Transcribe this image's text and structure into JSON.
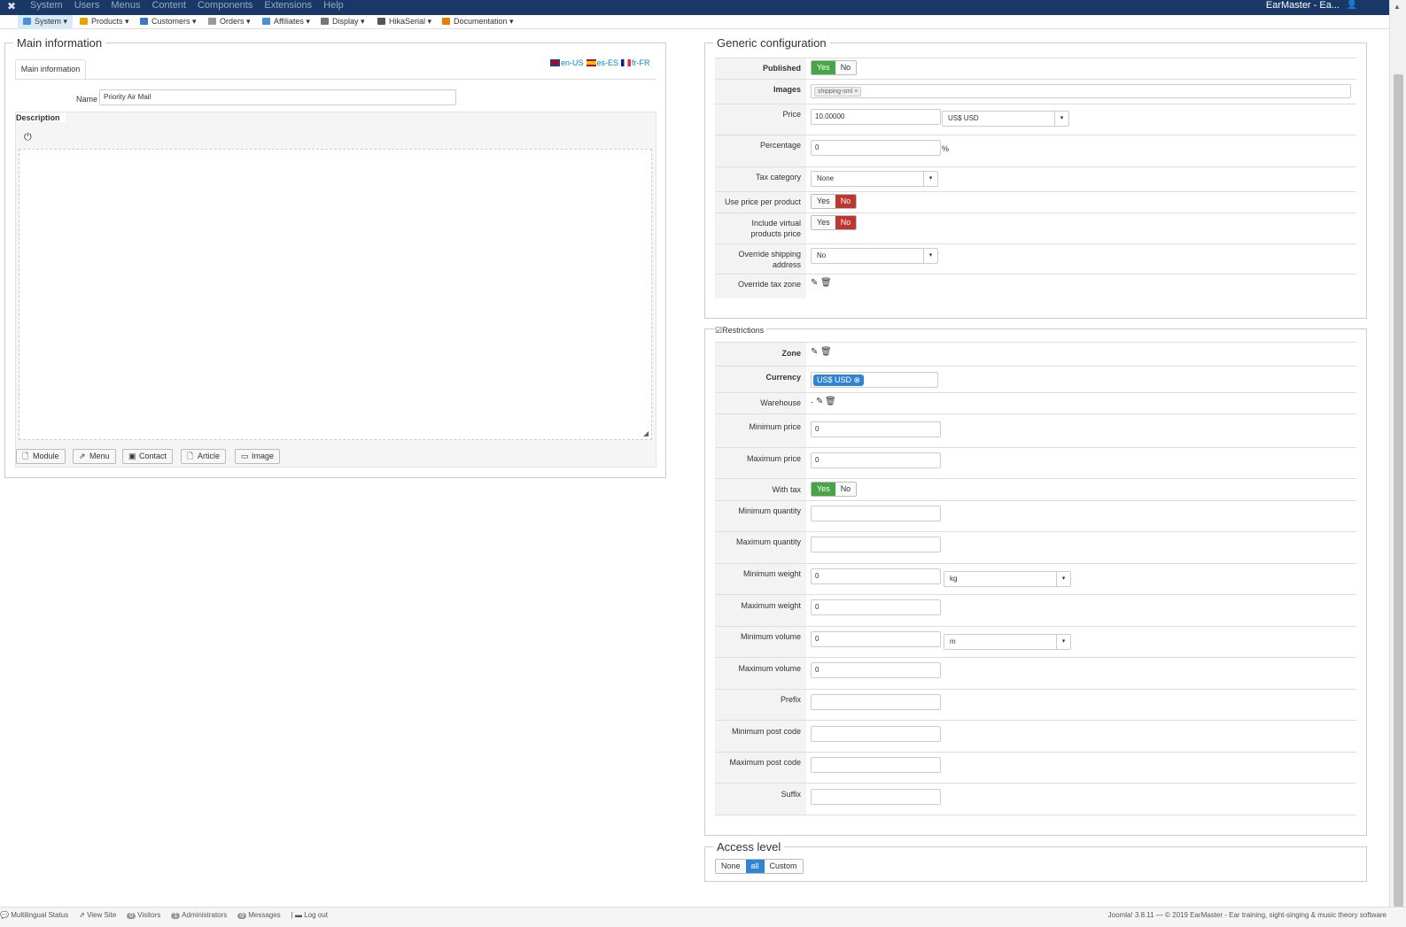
{
  "topbar": {
    "menu": [
      "System",
      "Users",
      "Menus",
      "Content",
      "Components",
      "Extensions",
      "Help"
    ],
    "site_title": "EarMaster - Ea..."
  },
  "hikamenu": {
    "items": [
      {
        "label": "System",
        "color": "#4a90d9"
      },
      {
        "label": "Products",
        "color": "#e8a400"
      },
      {
        "label": "Customers",
        "color": "#3a78c2"
      },
      {
        "label": "Orders",
        "color": "#999999"
      },
      {
        "label": "Affiliates",
        "color": "#4a90d9"
      },
      {
        "label": "Display",
        "color": "#777777"
      },
      {
        "label": "HikaSerial",
        "color": "#555555"
      },
      {
        "label": "Documentation",
        "color": "#e87e04"
      }
    ]
  },
  "main": {
    "legend": "Main information",
    "tab": "Main information",
    "langs": [
      "en-US",
      "es-ES",
      "fr-FR"
    ],
    "name_label": "Name",
    "name_value": "Priority Air Mail",
    "description_label": "Description",
    "editor_buttons": [
      "Module",
      "Menu",
      "Contact",
      "Article",
      "Image"
    ]
  },
  "generic": {
    "legend": "Generic configuration",
    "published_label": "Published",
    "images_label": "Images",
    "image_tag": "shipping-sml",
    "price_label": "Price",
    "price_value": "10.00000",
    "currency_select": "US$ USD",
    "percentage_label": "Percentage",
    "percentage_value": "0",
    "percent_sign": "%",
    "tax_label": "Tax category",
    "tax_value": "None",
    "use_price_label": "Use price per product",
    "virtual_label_1": "Include virtual",
    "virtual_label_2": "products price",
    "override_ship_label_1": "Override shipping",
    "override_ship_label_2": "address",
    "override_ship_value": "No",
    "override_tax_label": "Override tax zone",
    "yes": "Yes",
    "no": "No"
  },
  "restrictions": {
    "legend": "Restrictions",
    "zone_label": "Zone",
    "currency_label": "Currency",
    "currency_tag": "US$ USD",
    "warehouse_label": "Warehouse",
    "warehouse_value": "-",
    "min_price_label": "Minimum price",
    "min_price_value": "0",
    "max_price_label": "Maximum price",
    "max_price_value": "0",
    "with_tax_label": "With tax",
    "min_qty_label": "Minimum quantity",
    "max_qty_label": "Maximum quantity",
    "min_weight_label": "Minimum weight",
    "min_weight_value": "0",
    "weight_unit": "kg",
    "max_weight_label": "Maximum weight",
    "max_weight_value": "0",
    "min_volume_label": "Minimum volume",
    "min_volume_value": "0",
    "volume_unit": "m",
    "max_volume_label": "Maximum volume",
    "max_volume_value": "0",
    "prefix_label": "Prefix",
    "min_post_label": "Minimum post code",
    "max_post_label": "Maximum post code",
    "suffix_label": "Suffix"
  },
  "access": {
    "legend": "Access level",
    "options": [
      "None",
      "all",
      "Custom"
    ]
  },
  "footer": {
    "multilingual": "Multilingual Status",
    "view_site": "View Site",
    "visitors_count": "0",
    "visitors": "Visitors",
    "admins_count": "1",
    "admins": "Administrators",
    "messages_count": "0",
    "messages": "Messages",
    "logout": "Log out",
    "copyright": "Joomla! 3.8.11 — © 2019 EarMaster - Ear training, sight-singing & music theory software"
  }
}
